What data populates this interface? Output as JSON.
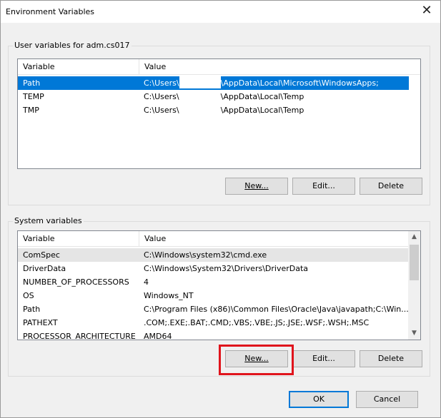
{
  "window": {
    "title": "Environment Variables",
    "close_glyph": "✕"
  },
  "user_vars": {
    "legend": "User variables for adm.cs017",
    "columns": [
      "Variable",
      "Value"
    ],
    "rows": [
      {
        "variable": "Path",
        "value_prefix": "C:\\Users\\",
        "value_suffix": "\\AppData\\Local\\Microsoft\\WindowsApps;",
        "selected": true
      },
      {
        "variable": "TEMP",
        "value_prefix": "C:\\Users\\",
        "value_suffix": "\\AppData\\Local\\Temp"
      },
      {
        "variable": "TMP",
        "value_prefix": "C:\\Users\\",
        "value_suffix": "\\AppData\\Local\\Temp"
      }
    ],
    "buttons": {
      "new": "New...",
      "edit": "Edit...",
      "delete": "Delete"
    }
  },
  "system_vars": {
    "legend": "System variables",
    "columns": [
      "Variable",
      "Value"
    ],
    "rows": [
      {
        "variable": "ComSpec",
        "value": "C:\\Windows\\system32\\cmd.exe",
        "hover": true
      },
      {
        "variable": "DriverData",
        "value": "C:\\Windows\\System32\\Drivers\\DriverData"
      },
      {
        "variable": "NUMBER_OF_PROCESSORS",
        "value": "4"
      },
      {
        "variable": "OS",
        "value": "Windows_NT"
      },
      {
        "variable": "Path",
        "value": "C:\\Program Files (x86)\\Common Files\\Oracle\\Java\\javapath;C:\\Win..."
      },
      {
        "variable": "PATHEXT",
        "value": ".COM;.EXE;.BAT;.CMD;.VBS;.VBE;.JS;.JSE;.WSF;.WSH;.MSC"
      },
      {
        "variable": "PROCESSOR_ARCHITECTURE",
        "value": "AMD64"
      }
    ],
    "buttons": {
      "new": "New...",
      "edit": "Edit...",
      "delete": "Delete"
    }
  },
  "dialog_buttons": {
    "ok": "OK",
    "cancel": "Cancel"
  },
  "colors": {
    "selection": "#0078d7",
    "highlight": "#e0141c"
  }
}
